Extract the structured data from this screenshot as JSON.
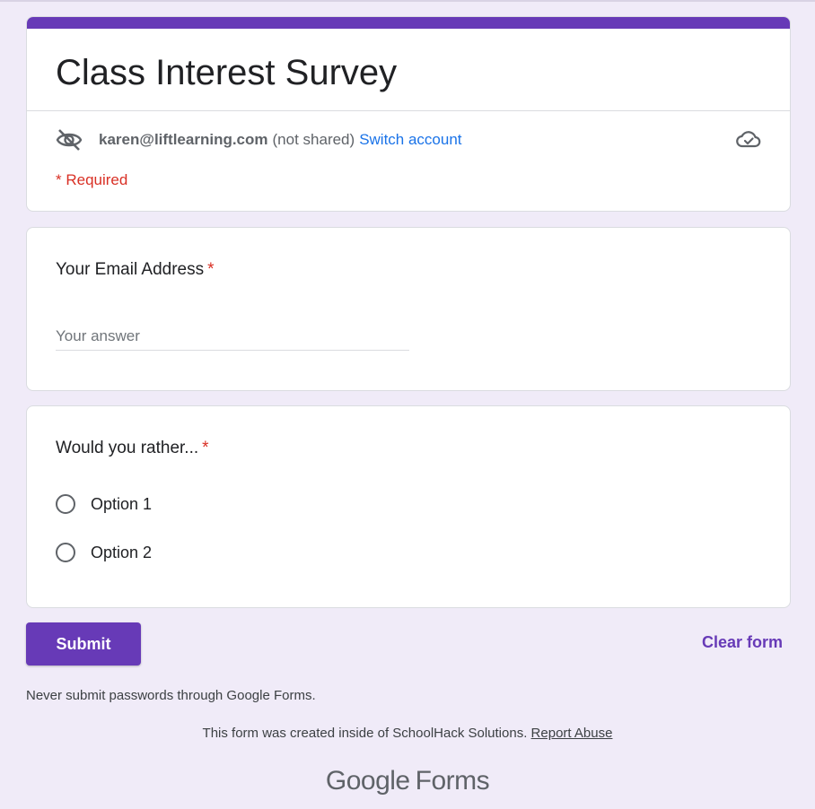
{
  "header": {
    "title": "Class Interest Survey",
    "account_email": "karen@liftlearning.com",
    "not_shared": "(not shared)",
    "switch_account": "Switch account",
    "required_note": "* Required",
    "accent_color": "#673ab7",
    "hidden_icon": "eye-off-icon",
    "saved_icon": "cloud-check-icon"
  },
  "questions": [
    {
      "title": "Your Email Address",
      "required_mark": "*",
      "type": "short-answer",
      "placeholder": "Your answer",
      "value": ""
    },
    {
      "title": "Would you rather...",
      "required_mark": "*",
      "type": "multiple-choice",
      "options": [
        {
          "label": "Option 1",
          "selected": false
        },
        {
          "label": "Option 2",
          "selected": false
        }
      ]
    }
  ],
  "actions": {
    "submit_label": "Submit",
    "clear_label": "Clear form"
  },
  "footer": {
    "password_warning": "Never submit passwords through Google Forms.",
    "created_note": "This form was created inside of SchoolHack Solutions.",
    "report_abuse": "Report Abuse",
    "brand_google": "Google",
    "brand_forms": "Forms"
  }
}
